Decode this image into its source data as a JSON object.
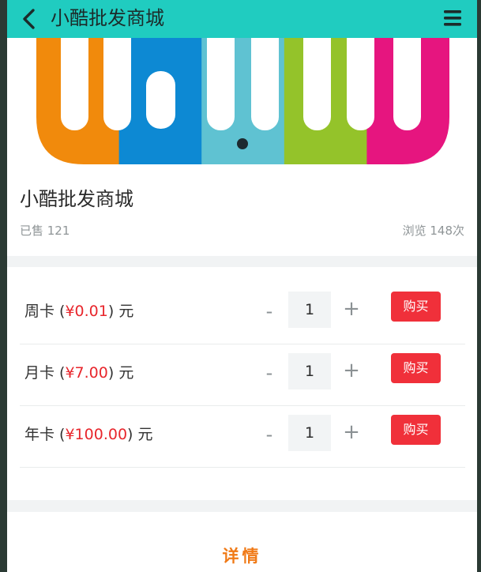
{
  "header": {
    "title": "小酷批发商城",
    "back_icon": "chevron-left-icon",
    "menu_icon": "hamburger-menu-icon",
    "background_color": "#20ccc0"
  },
  "banner": {
    "logo_colors": [
      "#f18a0c",
      "#0d89d3",
      "#5fc2d2",
      "#94c32a",
      "#e6157f"
    ],
    "carousel_active_index": 0,
    "carousel_count": 1
  },
  "product": {
    "name": "小酷批发商城",
    "sold_text": "已售 121",
    "views_text": "浏览 148次"
  },
  "options": [
    {
      "name": "周卡",
      "price": "¥0.01",
      "unit": "元",
      "quantity": "1",
      "minus_label": "-",
      "plus_label": "+",
      "buy_label": "购买"
    },
    {
      "name": "月卡",
      "price": "¥7.00",
      "unit": "元",
      "quantity": "1",
      "minus_label": "-",
      "plus_label": "+",
      "buy_label": "购买"
    },
    {
      "name": "年卡",
      "price": "¥100.00",
      "unit": "元",
      "quantity": "1",
      "minus_label": "-",
      "plus_label": "+",
      "buy_label": "购买"
    }
  ],
  "details": {
    "title": "详情"
  },
  "colors": {
    "price": "#e8262c",
    "buy_button": "#f0303a",
    "details_title": "#f07a17"
  }
}
